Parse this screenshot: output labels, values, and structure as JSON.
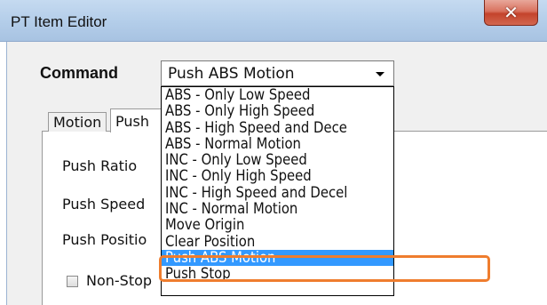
{
  "window": {
    "title": "PT Item Editor",
    "close_glyph": "✕"
  },
  "command": {
    "label": "Command",
    "selected": "Push ABS Motion",
    "options": [
      "ABS - Only Low Speed",
      "ABS - Only High Speed",
      "ABS - High Speed and Dece",
      "ABS - Normal Motion",
      "INC - Only Low Speed",
      "INC - Only High Speed",
      "INC - High Speed and Decel",
      "INC - Normal Motion",
      "Move Origin",
      "Clear Position",
      "Push ABS Motion",
      "Push Stop"
    ],
    "highlighted_index": 10
  },
  "tabs": [
    {
      "label": "Motion"
    },
    {
      "label": "Push"
    }
  ],
  "fields": {
    "push_ratio": "Push Ratio",
    "push_speed": "Push Speed",
    "push_position": "Push Positio",
    "non_stop": "Non-Stop"
  },
  "colors": {
    "selection": "#3399ff",
    "annotation": "#ef7d2e"
  }
}
